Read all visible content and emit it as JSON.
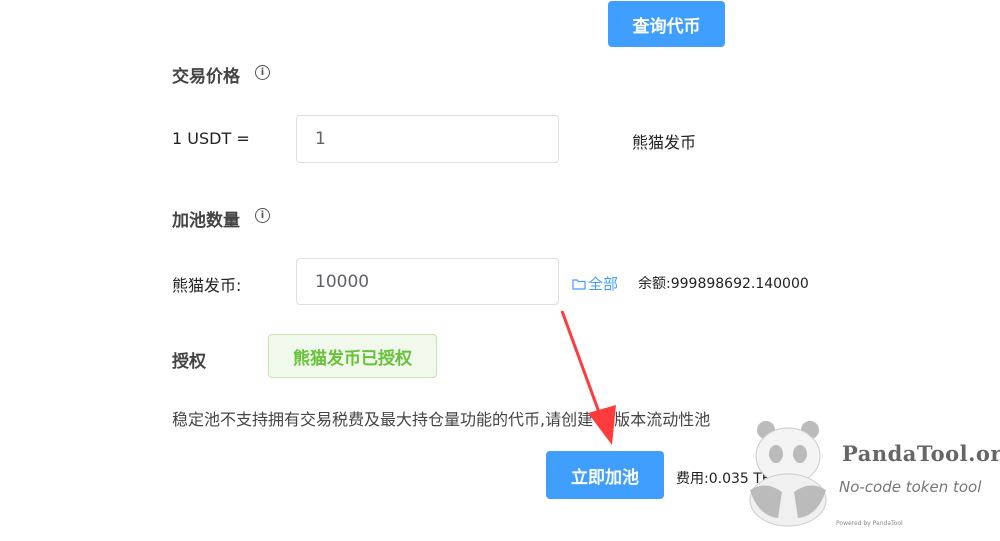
{
  "query_button_label": "查询代币",
  "trade_price": {
    "heading": "交易价格",
    "prefix": "1 USDT =",
    "input_value": "1",
    "token_name": "熊猫发币"
  },
  "pool_amount": {
    "heading": "加池数量",
    "token_label": "熊猫发币:",
    "input_value": "10000",
    "all_label": "全部",
    "balance_text": "余额:999898692.140000"
  },
  "authorize": {
    "label": "授权",
    "status_button_label": "熊猫发币已授权"
  },
  "notice_text": "稳定池不支持拥有交易税费及最大持仓量功能的代币,请创建V2版本流动性池",
  "add_pool_button_label": "立即加池",
  "fee_text": "费用:0.035 TBNB",
  "watermark": {
    "title": "PandaTool.org",
    "subtitle": "No-code token tool",
    "powered_by": "Powered by PandaTool"
  },
  "colors": {
    "primary": "#409eff",
    "success_text": "#67c23a",
    "success_bg": "#f0f9eb",
    "arrow": "#ff3b3b"
  },
  "icons": {
    "info": "info-circle-icon",
    "folder": "folder-icon",
    "arrow": "red-arrow-annotation",
    "logo": "panda-logo-icon"
  }
}
